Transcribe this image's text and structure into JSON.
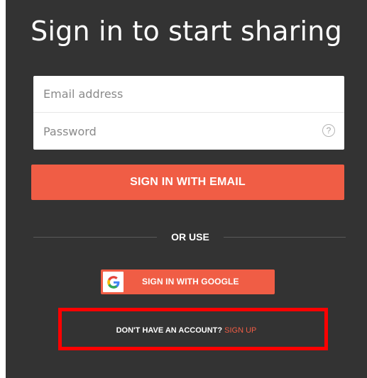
{
  "header": {
    "title": "Sign in to start sharing"
  },
  "form": {
    "email_placeholder": "Email address",
    "email_value": "",
    "password_placeholder": "Password",
    "password_value": "",
    "help_icon_glyph": "?",
    "help_icon": "question-circle-icon"
  },
  "actions": {
    "email_button_label": "SIGN IN WITH EMAIL",
    "divider_label": "OR USE",
    "google_button_label": "SIGN IN WITH GOOGLE",
    "google_logo_letter": "G"
  },
  "footer": {
    "prompt": "DON'T HAVE AN ACCOUNT?",
    "signup_link": "SIGN UP"
  },
  "colors": {
    "background": "#333333",
    "accent": "#f05d45",
    "highlight": "#ff0000"
  }
}
